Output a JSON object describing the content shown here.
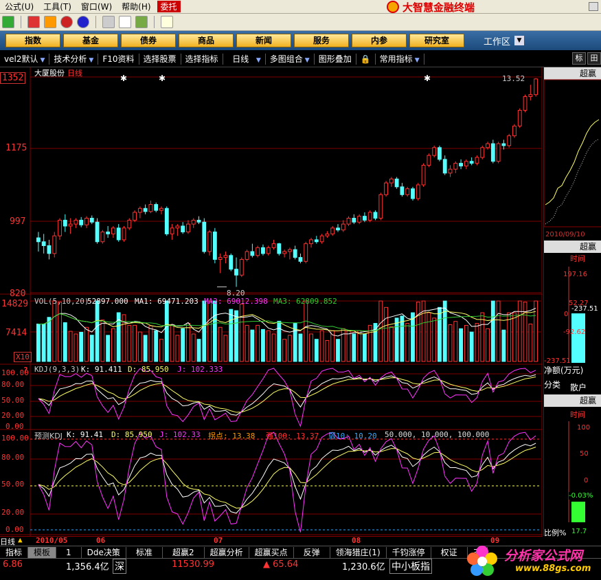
{
  "menu": [
    {
      "label": "公式",
      "key": "(U)",
      "name": "menu-formula"
    },
    {
      "label": "工具",
      "key": "(T)",
      "name": "menu-tools"
    },
    {
      "label": "窗口",
      "key": "(W)",
      "name": "menu-window"
    },
    {
      "label": "帮助",
      "key": "(H)",
      "name": "menu-help"
    }
  ],
  "menu_entrust": "委托",
  "brand_title": "大智慧金融终端",
  "categories": [
    "指数",
    "基金",
    "债券",
    "商品",
    "新闻",
    "服务",
    "内参",
    "研究室"
  ],
  "workarea": "工作区",
  "funcs": [
    {
      "label": "vel2默认",
      "dd": true
    },
    {
      "label": "技术分析",
      "dd": true
    },
    {
      "label": "F10资料",
      "dd": false
    },
    {
      "label": "选择股票",
      "dd": false
    },
    {
      "label": "选择指标",
      "dd": false
    },
    {
      "label": "日线",
      "dd": true
    },
    {
      "label": "多图组合",
      "dd": true
    },
    {
      "label": "图形叠加",
      "dd": false
    },
    {
      "label": "常用指标",
      "dd": true
    }
  ],
  "fn_right": [
    "标",
    "田"
  ],
  "chart": {
    "stock_name": "大厦股份",
    "period": "日线",
    "price_axis": {
      "top": "1352",
      "t1": "1175",
      "t2": "997",
      "bottom": "820"
    },
    "high_note": "13.52",
    "low_note": "8.20",
    "candles": [
      [
        9.45,
        9.6,
        9.1,
        9.35
      ],
      [
        9.35,
        9.55,
        9.05,
        9.25
      ],
      [
        9.25,
        9.4,
        8.9,
        9.05
      ],
      [
        9.05,
        9.6,
        8.95,
        9.5
      ],
      [
        9.5,
        9.95,
        9.4,
        9.9
      ],
      [
        9.9,
        10.05,
        9.6,
        9.75
      ],
      [
        9.75,
        9.95,
        9.55,
        9.8
      ],
      [
        9.8,
        9.95,
        9.7,
        9.9
      ],
      [
        9.9,
        9.98,
        9.72,
        9.78
      ],
      [
        9.78,
        10.0,
        9.7,
        9.95
      ],
      [
        9.95,
        10.02,
        9.8,
        9.85
      ],
      [
        9.85,
        9.95,
        9.3,
        9.35
      ],
      [
        9.35,
        9.65,
        9.3,
        9.6
      ],
      [
        9.6,
        9.75,
        9.45,
        9.55
      ],
      [
        9.55,
        9.75,
        9.45,
        9.7
      ],
      [
        9.7,
        9.8,
        9.35,
        9.4
      ],
      [
        9.4,
        9.75,
        9.35,
        9.7
      ],
      [
        9.7,
        9.95,
        9.65,
        9.9
      ],
      [
        9.9,
        10.15,
        9.85,
        10.1
      ],
      [
        10.1,
        10.25,
        9.95,
        10.2
      ],
      [
        10.2,
        10.3,
        10.05,
        10.12
      ],
      [
        10.12,
        10.4,
        10.08,
        10.3
      ],
      [
        10.3,
        10.35,
        10.1,
        10.15
      ],
      [
        10.15,
        10.25,
        10.05,
        10.2
      ],
      [
        10.2,
        10.25,
        9.5,
        9.55
      ],
      [
        9.55,
        9.8,
        9.4,
        9.7
      ],
      [
        9.7,
        9.8,
        9.5,
        9.75
      ],
      [
        9.75,
        9.85,
        9.55,
        9.6
      ],
      [
        9.6,
        9.9,
        9.55,
        9.8
      ],
      [
        9.8,
        9.95,
        9.7,
        9.9
      ],
      [
        9.9,
        10.0,
        9.8,
        9.85
      ],
      [
        9.85,
        9.95,
        9.05,
        9.1
      ],
      [
        9.1,
        9.65,
        9.0,
        9.6
      ],
      [
        9.6,
        9.7,
        8.8,
        8.9
      ],
      [
        8.9,
        9.05,
        8.55,
        8.95
      ],
      [
        8.95,
        9.1,
        8.8,
        9.0
      ],
      [
        9.0,
        9.05,
        8.6,
        8.65
      ],
      [
        8.65,
        8.95,
        8.2,
        8.5
      ],
      [
        8.5,
        8.95,
        8.45,
        8.9
      ],
      [
        8.9,
        9.15,
        8.85,
        9.1
      ],
      [
        9.1,
        9.3,
        8.95,
        9.0
      ],
      [
        9.0,
        9.25,
        8.95,
        9.2
      ],
      [
        9.2,
        9.28,
        9.0,
        9.05
      ],
      [
        9.05,
        9.25,
        9.0,
        9.2
      ],
      [
        9.2,
        9.4,
        9.15,
        9.3
      ],
      [
        9.3,
        9.32,
        9.0,
        9.05
      ],
      [
        9.05,
        9.15,
        8.95,
        9.1
      ],
      [
        9.1,
        9.2,
        8.9,
        9.15
      ],
      [
        9.15,
        9.25,
        8.9,
        8.95
      ],
      [
        8.95,
        9.05,
        8.8,
        8.85
      ],
      [
        8.85,
        9.35,
        8.8,
        9.3
      ],
      [
        9.3,
        9.45,
        9.2,
        9.4
      ],
      [
        9.4,
        9.5,
        9.3,
        9.35
      ],
      [
        9.35,
        9.55,
        9.3,
        9.5
      ],
      [
        9.5,
        9.62,
        9.45,
        9.55
      ],
      [
        9.55,
        9.75,
        9.5,
        9.7
      ],
      [
        9.7,
        9.8,
        9.6,
        9.65
      ],
      [
        9.65,
        9.9,
        9.6,
        9.8
      ],
      [
        9.8,
        10.0,
        9.75,
        9.95
      ],
      [
        9.95,
        10.05,
        9.8,
        9.85
      ],
      [
        9.85,
        10.05,
        9.8,
        10.0
      ],
      [
        10.0,
        10.1,
        9.85,
        9.9
      ],
      [
        9.9,
        10.15,
        9.85,
        10.1
      ],
      [
        10.1,
        10.15,
        9.9,
        9.95
      ],
      [
        9.95,
        10.6,
        9.9,
        10.55
      ],
      [
        10.55,
        10.9,
        10.5,
        10.85
      ],
      [
        10.85,
        11.0,
        10.75,
        10.95
      ],
      [
        10.95,
        11.0,
        10.7,
        10.75
      ],
      [
        10.75,
        10.85,
        10.5,
        10.55
      ],
      [
        10.55,
        10.75,
        10.5,
        10.7
      ],
      [
        10.7,
        10.75,
        10.4,
        10.45
      ],
      [
        10.45,
        10.85,
        10.4,
        10.8
      ],
      [
        10.8,
        11.35,
        10.75,
        11.3
      ],
      [
        11.3,
        11.6,
        11.25,
        11.55
      ],
      [
        11.55,
        11.8,
        11.5,
        11.75
      ],
      [
        11.75,
        11.8,
        11.4,
        11.45
      ],
      [
        11.45,
        11.55,
        11.05,
        11.1
      ],
      [
        11.1,
        11.3,
        11.0,
        11.2
      ],
      [
        11.2,
        11.4,
        11.1,
        11.35
      ],
      [
        11.35,
        11.45,
        11.2,
        11.28
      ],
      [
        11.28,
        11.45,
        11.2,
        11.4
      ],
      [
        11.4,
        11.5,
        11.3,
        11.35
      ],
      [
        11.35,
        11.55,
        11.3,
        11.5
      ],
      [
        11.5,
        11.8,
        11.45,
        11.75
      ],
      [
        11.75,
        11.9,
        11.7,
        11.85
      ],
      [
        11.85,
        11.95,
        11.35,
        11.4
      ],
      [
        11.4,
        11.9,
        11.35,
        11.85
      ],
      [
        11.85,
        11.95,
        11.7,
        11.8
      ],
      [
        11.8,
        12.1,
        11.75,
        12.05
      ],
      [
        12.05,
        12.35,
        12.0,
        12.3
      ],
      [
        12.3,
        12.75,
        12.25,
        12.7
      ],
      [
        12.7,
        13.1,
        12.65,
        13.05
      ],
      [
        13.05,
        13.35,
        12.95,
        13.1
      ],
      [
        13.1,
        13.52,
        13.05,
        13.5
      ]
    ],
    "vol_header": {
      "name": "VOL(5,10,20)",
      "v0": "52897.000",
      "ma1": "MA1: 69471.203",
      "ma2": "MA2: 69012.398",
      "ma3": "MA3: 62809.852"
    },
    "vol_axis": {
      "top": "14829",
      "mid": "7414",
      "unit": "X10"
    },
    "kdj_header": {
      "name": "KDJ(9,3,3)",
      "k": "K: 91.411",
      "d": "D: 85.950",
      "j": "J: 102.333"
    },
    "kdj_axis": [
      "100.00",
      "80.00",
      "50.00",
      "20.00",
      "0.00"
    ],
    "pkdj_header": {
      "name": "预测KDJ",
      "k": "K: 91.41",
      "d": "D: 85.950",
      "j": "J: 102.33",
      "turn": "拐点: 13.38",
      "strong": "强100: 13.37",
      "weak": "弱10: 10.20",
      "tail": "50.000, 10.000, 100.000"
    },
    "pkdj_axis": [
      "100.00",
      "80.00",
      "50.00",
      "20.00",
      "0.00"
    ],
    "dates": [
      "2010/05",
      "06",
      "07",
      "08",
      "09"
    ],
    "date_prefix": "日线",
    "colors": {
      "up": "#ff3333",
      "down": "#54ffff",
      "grid": "#800000",
      "k": "#ffffff",
      "d": "#ffff66",
      "j": "#ff33ff",
      "ma1": "#ffffff",
      "ma2": "#ffff66",
      "ma3": "#33cc33"
    }
  },
  "rpanel": {
    "h1": "超赢",
    "date": "2010/09/10",
    "h2": "超赢",
    "time_label": "时间",
    "axis1": [
      "197.16",
      "52.27",
      "0",
      "-92.62",
      "-237.51"
    ],
    "bar1_value": "-237.51",
    "net_label": "净额(万元)",
    "class_label": "分类",
    "retail_label": "散户",
    "h3": "超赢",
    "axis2": [
      "100",
      "50",
      "0"
    ],
    "pct_value": "-0.03%",
    "ratio_label": "比例%",
    "ratio_value": "17.7"
  },
  "tabs": [
    "指标",
    "模板",
    "1",
    "Dde决策",
    "标准",
    "超赢2",
    "超赢分析",
    "超赢买点",
    "反弹",
    "领海猎庄(1)",
    "千钧涨停",
    "权证",
    "三"
  ],
  "active_tab": "模板",
  "status": {
    "s1": "6.86",
    "s2": "1,356.4亿",
    "s3": "深",
    "s4": "11530.99",
    "s5": "▲ 65.64",
    "s6": "1,230.6亿",
    "s7": "中小板指"
  },
  "watermark": {
    "line1": "分析家公式网",
    "line2": "www.88gs.com"
  }
}
